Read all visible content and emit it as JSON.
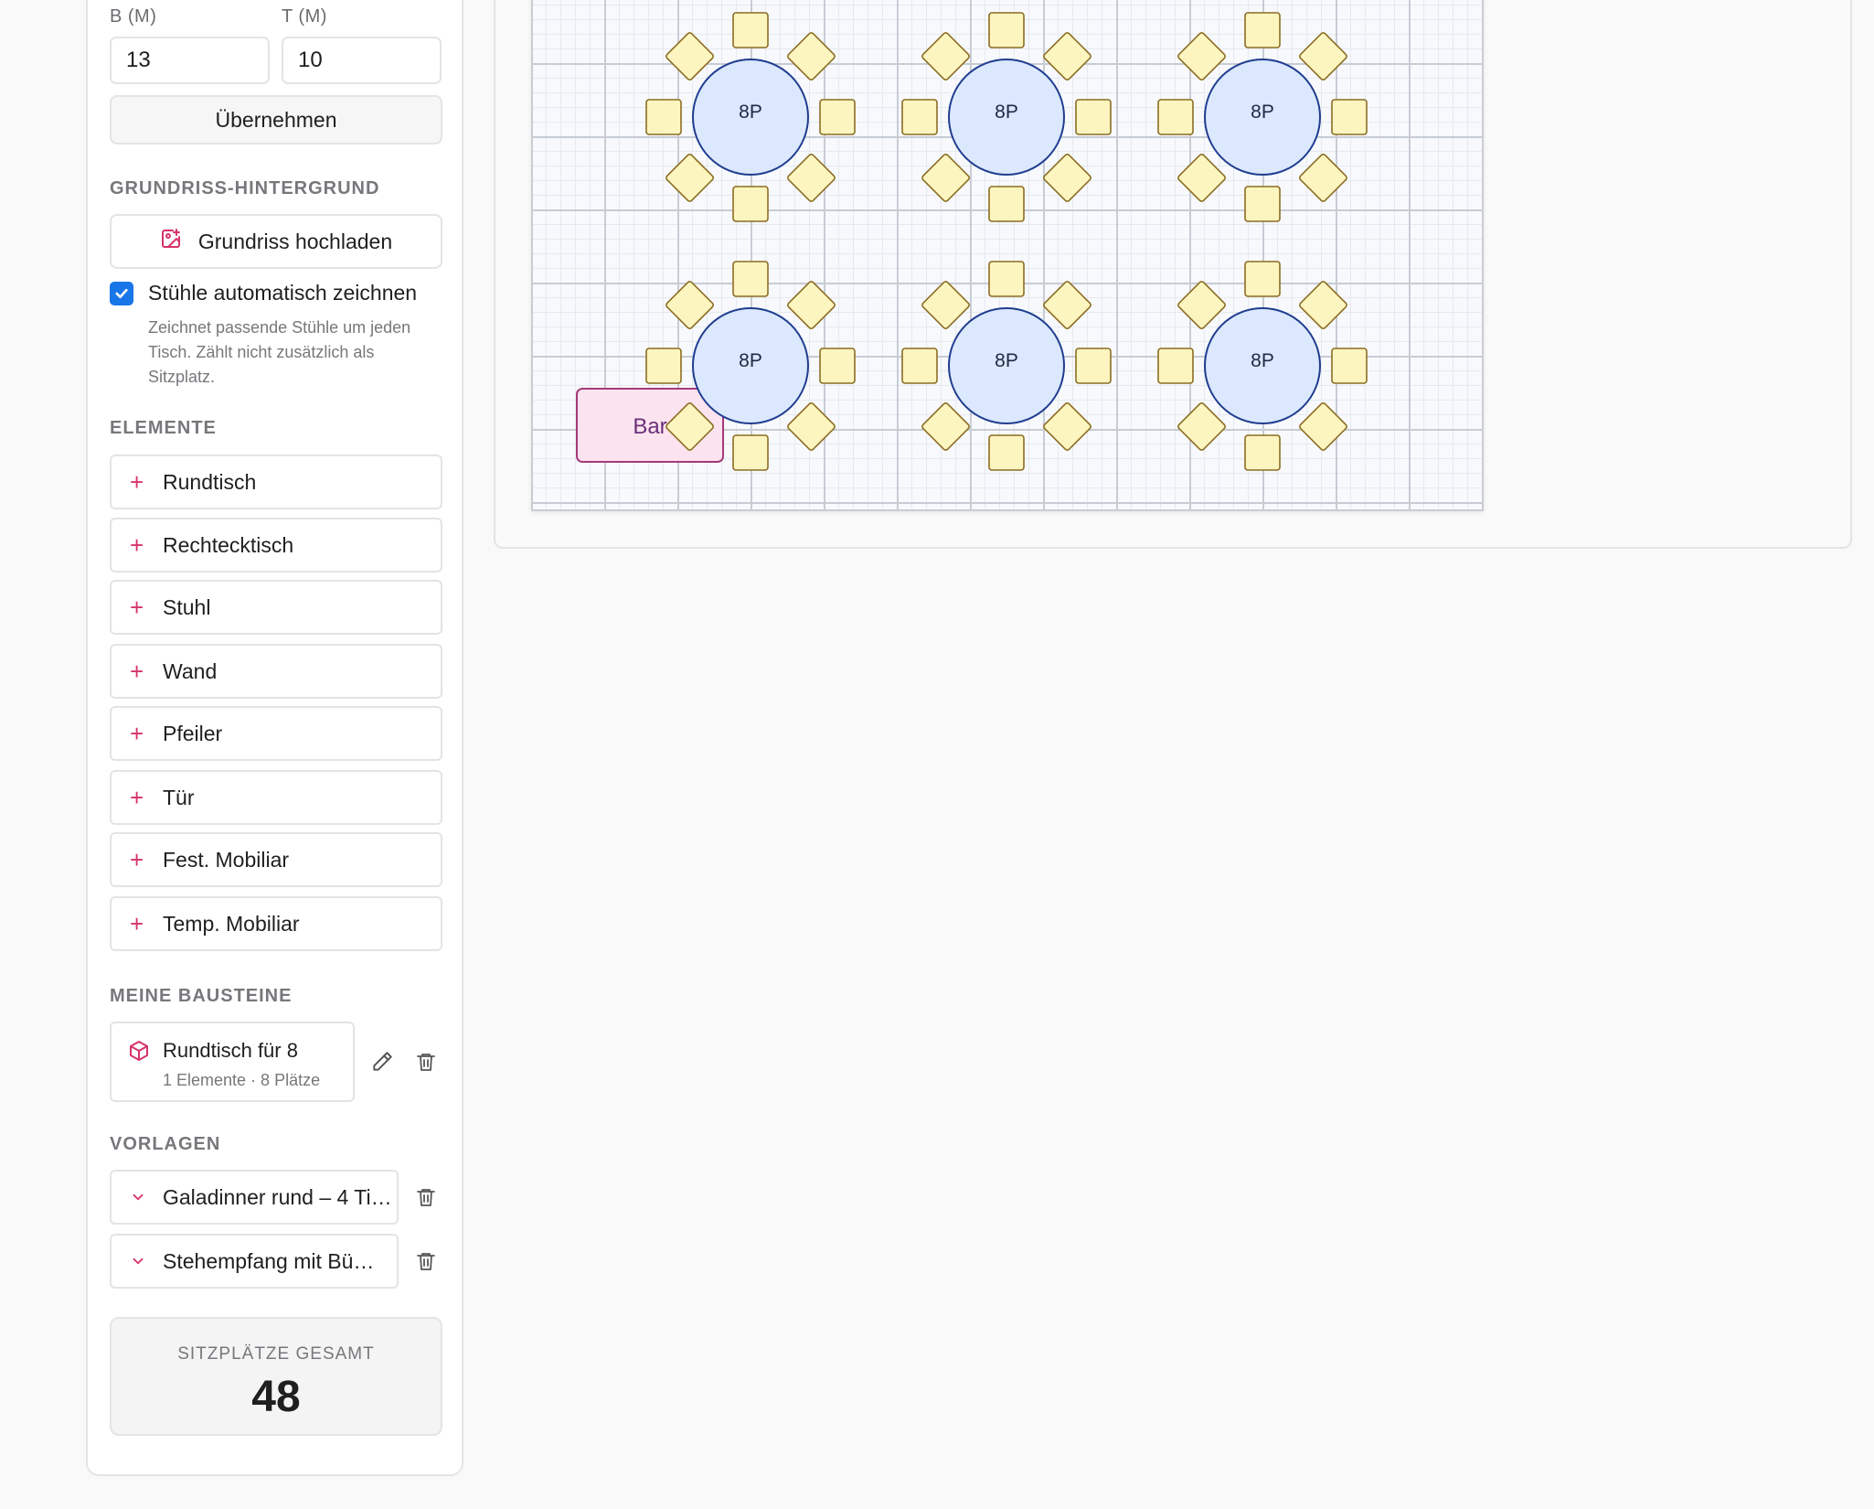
{
  "dimensions": {
    "width_label": "B (M)",
    "width_value": "13",
    "depth_label": "T (M)",
    "depth_value": "10",
    "apply_label": "Übernehmen"
  },
  "floorplan_bg": {
    "section_label": "GRUNDRISS-HINTERGRUND",
    "upload_label": "Grundriss hochladen"
  },
  "auto_chairs": {
    "checked": true,
    "label": "Stühle automatisch zeichnen",
    "hint": "Zeichnet passende Stühle um jeden Tisch. Zählt nicht zusätzlich als Sitzplatz."
  },
  "elements": {
    "section_label": "ELEMENTE",
    "items": [
      {
        "label": "Rundtisch"
      },
      {
        "label": "Rechtecktisch"
      },
      {
        "label": "Stuhl"
      },
      {
        "label": "Wand"
      },
      {
        "label": "Pfeiler"
      },
      {
        "label": "Tür"
      },
      {
        "label": "Fest. Mobiliar"
      },
      {
        "label": "Temp. Mobiliar"
      }
    ]
  },
  "my_blocks": {
    "section_label": "MEINE BAUSTEINE",
    "items": [
      {
        "title": "Rundtisch für 8",
        "subtitle": "1 Elemente · 8 Plätze"
      }
    ]
  },
  "templates": {
    "section_label": "VORLAGEN",
    "items": [
      {
        "label": "Galadinner rund – 4 Ti…"
      },
      {
        "label": "Stehempfang mit Bü…"
      }
    ]
  },
  "totals": {
    "label": "SITZPLÄTZE GESAMT",
    "value": "48"
  },
  "canvas": {
    "tables": [
      {
        "label": "8P"
      },
      {
        "label": "8P"
      },
      {
        "label": "8P"
      },
      {
        "label": "8P"
      },
      {
        "label": "8P"
      },
      {
        "label": "8P"
      }
    ],
    "bar_label": "Bar"
  },
  "colors": {
    "accent": "#d6336c",
    "checkbox": "#1976e8",
    "table_fill": "#dbe8fd",
    "table_stroke": "#1f3d8f",
    "chair_fill": "#fdf5c0",
    "chair_stroke": "#8c6d22",
    "bar_fill": "#fbe3ef",
    "bar_stroke": "#a43a79"
  }
}
